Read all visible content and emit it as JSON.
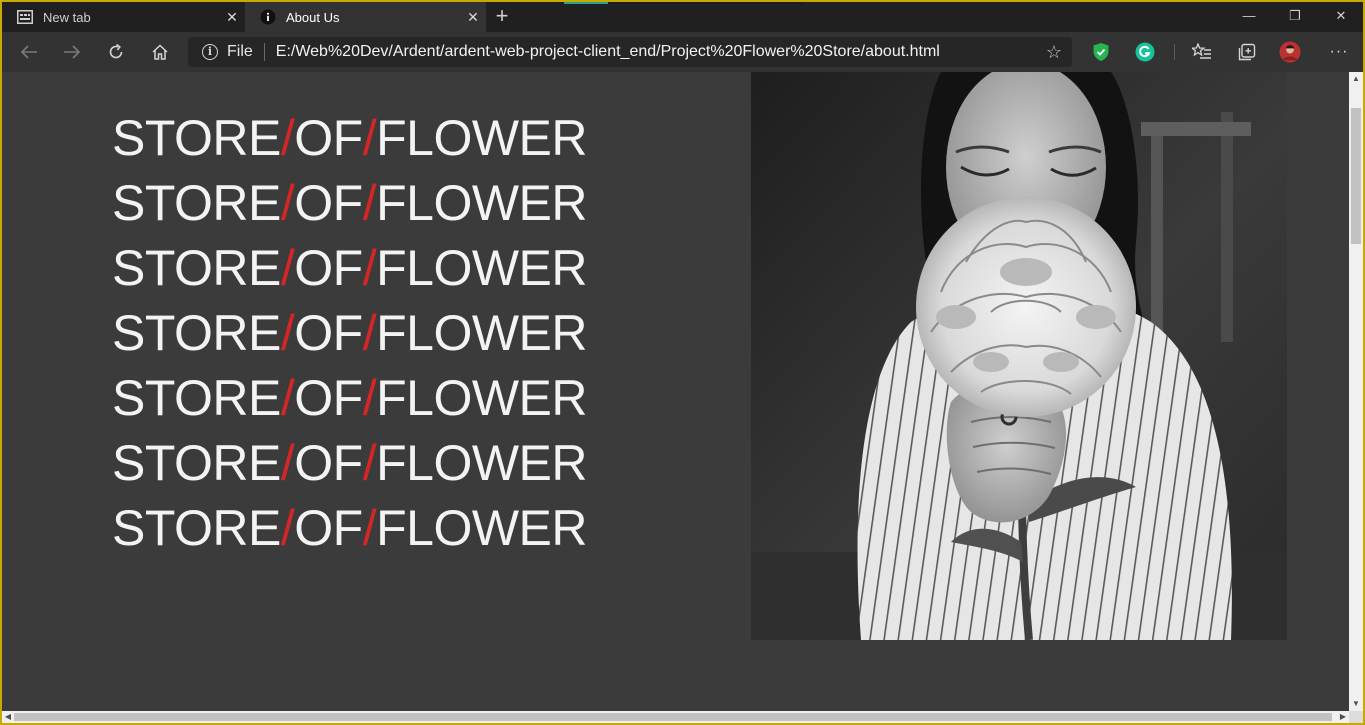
{
  "browser": {
    "tabs": [
      {
        "label": "New tab",
        "icon": "newtab-page-icon",
        "active": false
      },
      {
        "label": "About Us",
        "icon": "info-icon",
        "active": true
      }
    ],
    "new_tab_glyph": "+",
    "window_controls": {
      "minimize": "—",
      "restore": "❐",
      "close": "✕"
    },
    "toolbar": {
      "back_icon": "back-arrow-icon",
      "forward_icon": "forward-arrow-icon",
      "refresh_icon": "refresh-icon",
      "home_icon": "home-icon",
      "address": {
        "scheme_label": "File",
        "url": "E:/Web%20Dev/Ardent/ardent-web-project-client_end/Project%20Flower%20Store/about.html",
        "favorite_icon": "star-icon"
      },
      "extensions": [
        "shield-extension-icon",
        "grammarly-icon"
      ],
      "favorites_icon": "favorites-list-icon",
      "collections_icon": "collections-icon",
      "profile_icon": "avatar",
      "menu_glyph": "···"
    }
  },
  "page": {
    "lines": [
      {
        "a": "STORE",
        "b": "OF",
        "c": "FLOWER"
      },
      {
        "a": "STORE",
        "b": "OF",
        "c": "FLOWER"
      },
      {
        "a": "STORE",
        "b": "OF",
        "c": "FLOWER"
      },
      {
        "a": "STORE",
        "b": "OF",
        "c": "FLOWER"
      },
      {
        "a": "STORE",
        "b": "OF",
        "c": "FLOWER"
      },
      {
        "a": "STORE",
        "b": "OF",
        "c": "FLOWER"
      },
      {
        "a": "STORE",
        "b": "OF",
        "c": "FLOWER"
      }
    ],
    "separator": "/",
    "colors": {
      "text": "#f3f3f3",
      "separator": "#d42626",
      "background": "#3b3b3b"
    }
  }
}
